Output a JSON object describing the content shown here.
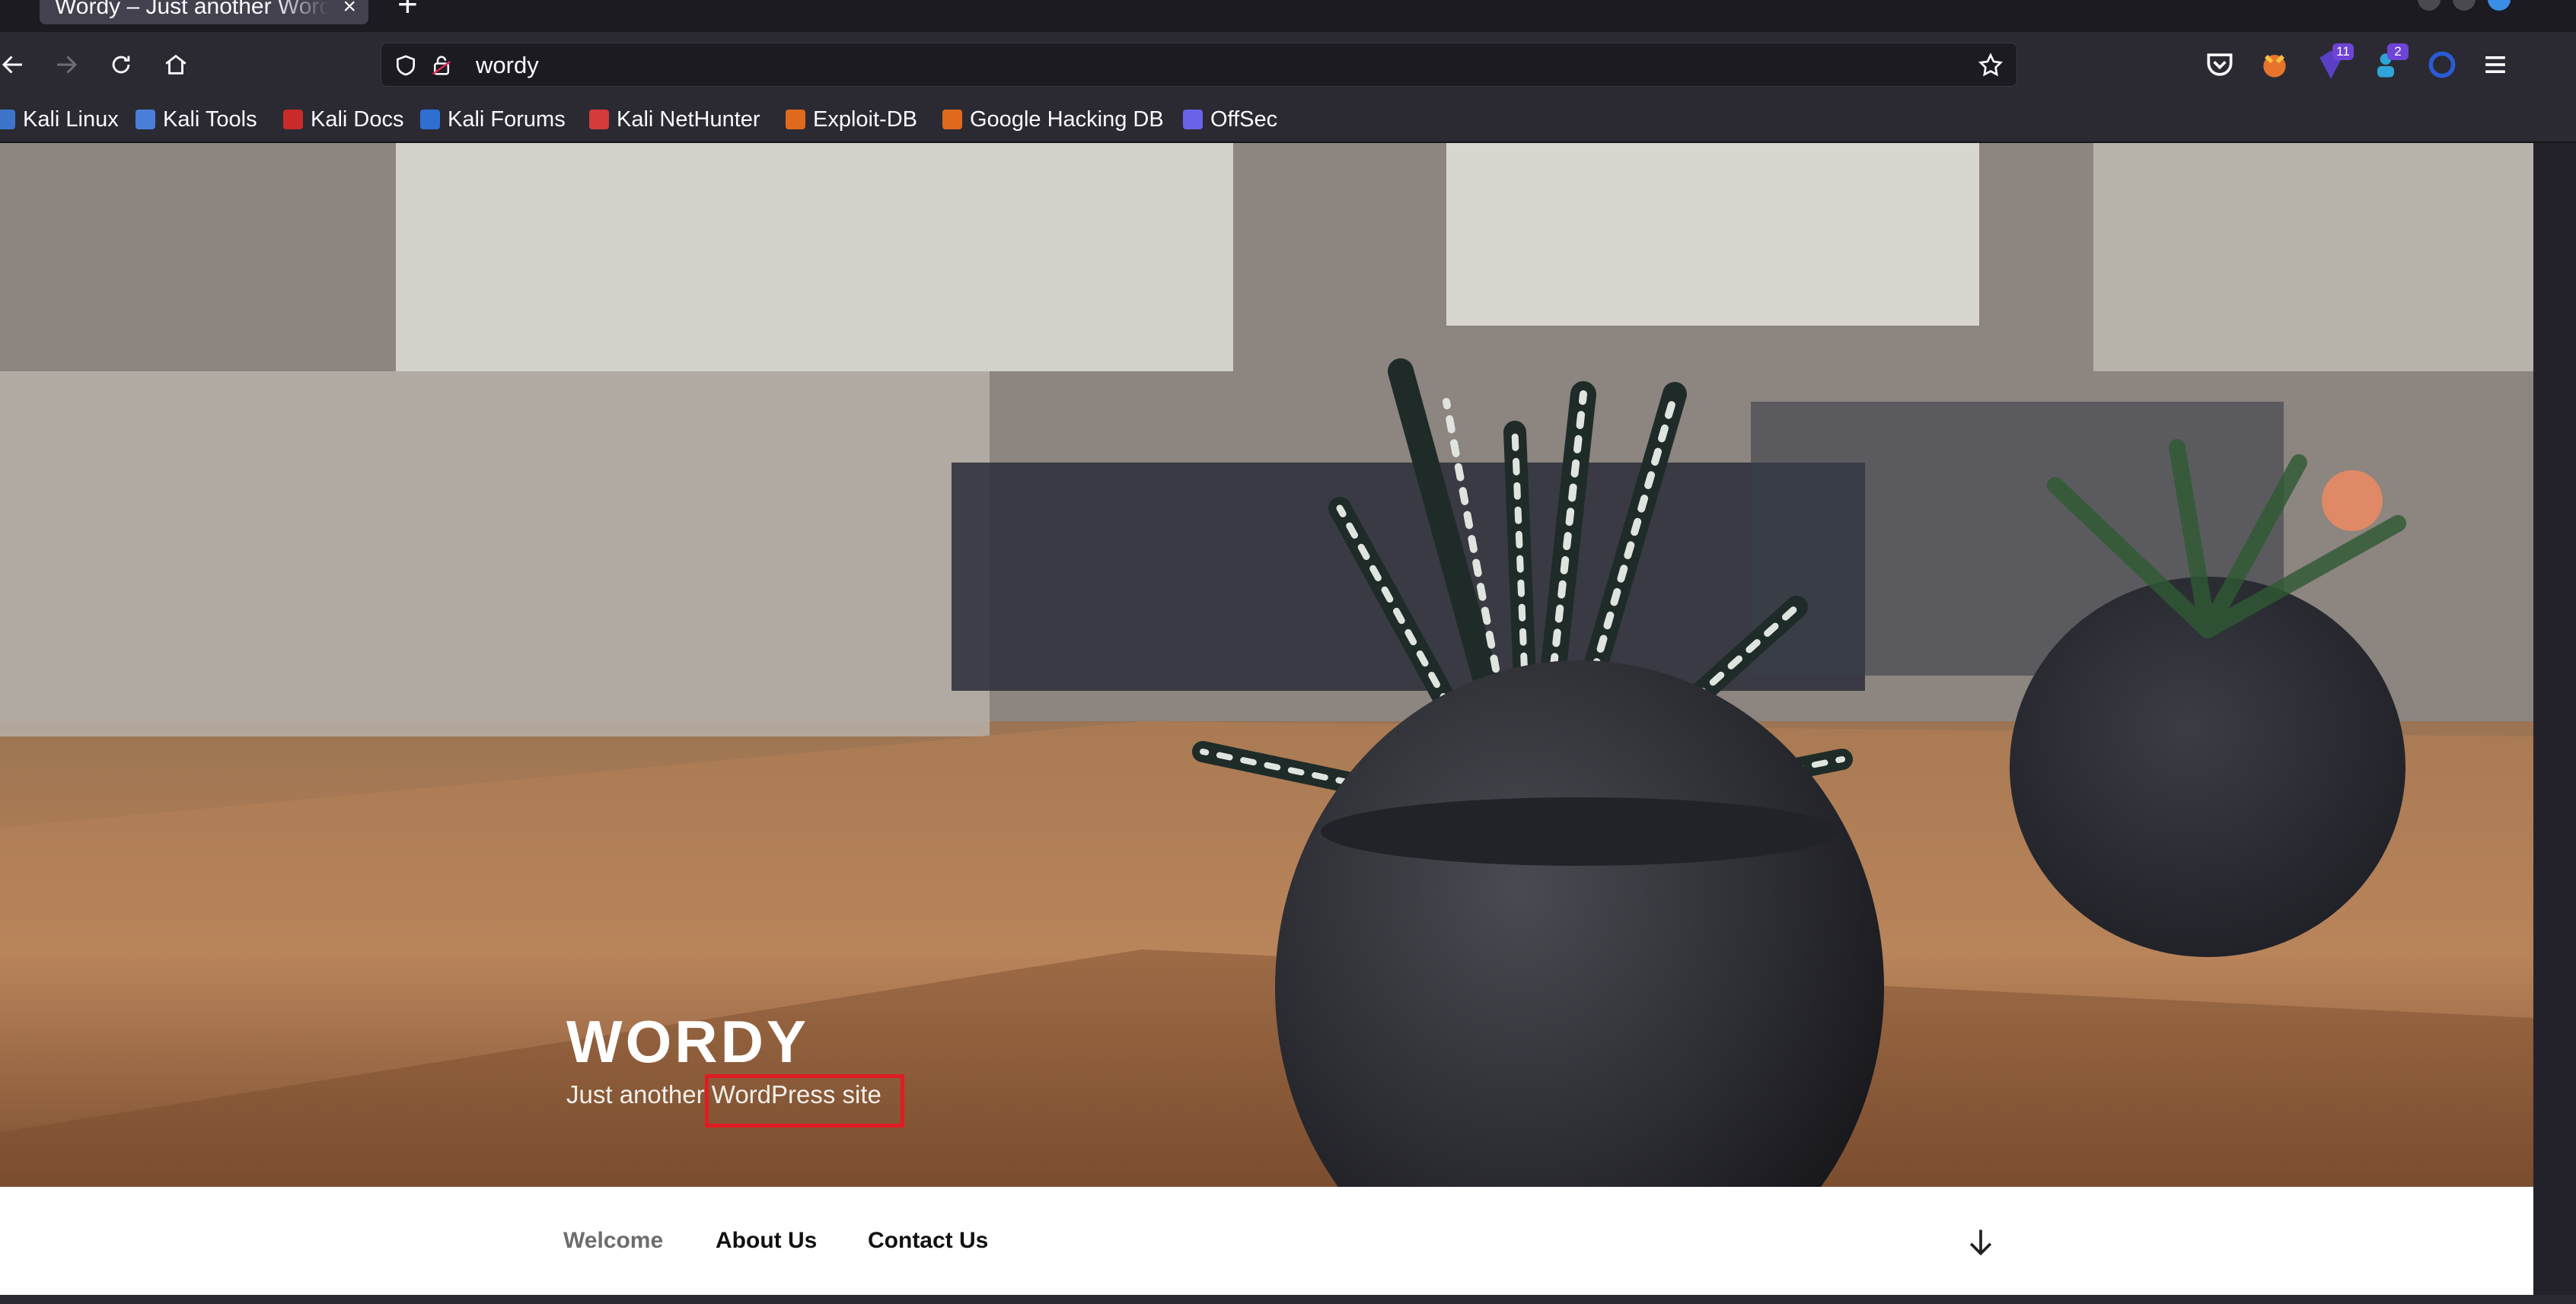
{
  "browser": {
    "tab_title": "Wordy – Just another WordPress site",
    "tab_close": "×",
    "new_tab": "+",
    "url": "wordy",
    "toolbar_badges": {
      "ext1": "11",
      "ext2": "2"
    }
  },
  "bookmarks": [
    {
      "label": "Kali Linux",
      "icon_color": "#3d74c9"
    },
    {
      "label": "Kali Tools",
      "icon_color": "#4a7ed8"
    },
    {
      "label": "Kali Docs",
      "icon_color": "#c92a2a"
    },
    {
      "label": "Kali Forums",
      "icon_color": "#2f6fd1"
    },
    {
      "label": "Kali NetHunter",
      "icon_color": "#d43a3a"
    },
    {
      "label": "Exploit-DB",
      "icon_color": "#e0691d"
    },
    {
      "label": "Google Hacking DB",
      "icon_color": "#e0691d"
    },
    {
      "label": "OffSec",
      "icon_color": "#6a62e8"
    }
  ],
  "site": {
    "title": "WORDY",
    "description": "Just another WordPress site",
    "highlight_color": "#e11b22"
  },
  "menu": {
    "items": [
      "Welcome",
      "About Us",
      "Contact Us"
    ]
  }
}
